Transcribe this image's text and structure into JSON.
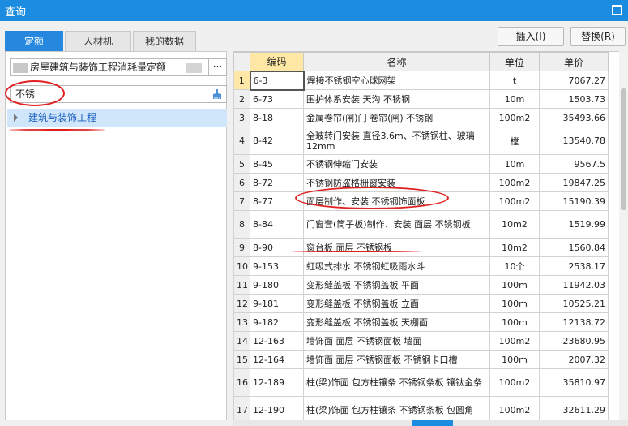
{
  "window": {
    "title": "查询"
  },
  "tabs": [
    {
      "label": "定额",
      "active": true
    },
    {
      "label": "人材机",
      "active": false
    },
    {
      "label": "我的数据",
      "active": false
    }
  ],
  "toolbar": {
    "insert_label": "插入(I)",
    "replace_label": "替换(R)"
  },
  "left": {
    "library_name": "房屋建筑与装饰工程消耗量定额",
    "more_label": "···",
    "search_value": "不锈",
    "tree_item": "建筑与装饰工程"
  },
  "grid": {
    "columns": [
      "编码",
      "名称",
      "单位",
      "单价"
    ],
    "rows": [
      {
        "n": "1",
        "code": "6-3",
        "name": "焊接不锈钢空心球网架",
        "unit": "t",
        "price": "7067.27"
      },
      {
        "n": "2",
        "code": "6-73",
        "name": "围护体系安装 天沟 不锈钢",
        "unit": "10m",
        "price": "1503.73"
      },
      {
        "n": "3",
        "code": "8-18",
        "name": "金属卷帘(闸)门 卷帘(闸) 不锈钢",
        "unit": "100m2",
        "price": "35493.66"
      },
      {
        "n": "4",
        "code": "8-42",
        "name": "全玻转门安装 直径3.6m、不锈钢柱、玻璃12mm",
        "unit": "樘",
        "price": "13540.78"
      },
      {
        "n": "5",
        "code": "8-45",
        "name": "不锈钢伸缩门安装",
        "unit": "10m",
        "price": "9567.5"
      },
      {
        "n": "6",
        "code": "8-72",
        "name": "不锈钢防盗格栅窗安装",
        "unit": "100m2",
        "price": "19847.25"
      },
      {
        "n": "7",
        "code": "8-77",
        "name": "面层制作、安装 不锈钢饰面板",
        "unit": "100m2",
        "price": "15190.39"
      },
      {
        "n": "8",
        "code": "8-84",
        "name": "门窗套(筒子板)制作、安装 面层 不锈钢板",
        "unit": "10m2",
        "price": "1519.99"
      },
      {
        "n": "9",
        "code": "8-90",
        "name": "窗台板 面层 不锈钢板",
        "unit": "10m2",
        "price": "1560.84"
      },
      {
        "n": "10",
        "code": "9-153",
        "name": "虹吸式排水 不锈钢虹吸雨水斗",
        "unit": "10个",
        "price": "2538.17"
      },
      {
        "n": "11",
        "code": "9-180",
        "name": "变形缝盖板 不锈钢盖板 平面",
        "unit": "100m",
        "price": "11942.03"
      },
      {
        "n": "12",
        "code": "9-181",
        "name": "变形缝盖板 不锈钢盖板 立面",
        "unit": "100m",
        "price": "10525.21"
      },
      {
        "n": "13",
        "code": "9-182",
        "name": "变形缝盖板 不锈钢盖板 天棚面",
        "unit": "100m",
        "price": "12138.72"
      },
      {
        "n": "14",
        "code": "12-163",
        "name": "墙饰面 面层 不锈钢面板 墙面",
        "unit": "100m2",
        "price": "23680.95"
      },
      {
        "n": "15",
        "code": "12-164",
        "name": "墙饰面 面层 不锈钢面板 不锈钢卡口槽",
        "unit": "100m",
        "price": "2007.32"
      },
      {
        "n": "16",
        "code": "12-189",
        "name": "柱(梁)饰面 包方柱镶条 不锈钢条板 镶钛金条",
        "unit": "100m2",
        "price": "35810.97"
      },
      {
        "n": "17",
        "code": "12-190",
        "name": "柱(梁)饰面 包方柱镶条 不锈钢条板 包圆角",
        "unit": "100m2",
        "price": "32611.29"
      }
    ]
  },
  "colors": {
    "accent": "#1c8ce0",
    "selected_header": "#ffe8a6",
    "annotation": "#e02020"
  },
  "icons": {
    "clear": "broom-icon",
    "maximize": "maximize-icon",
    "expand": "triangle-right-icon"
  }
}
